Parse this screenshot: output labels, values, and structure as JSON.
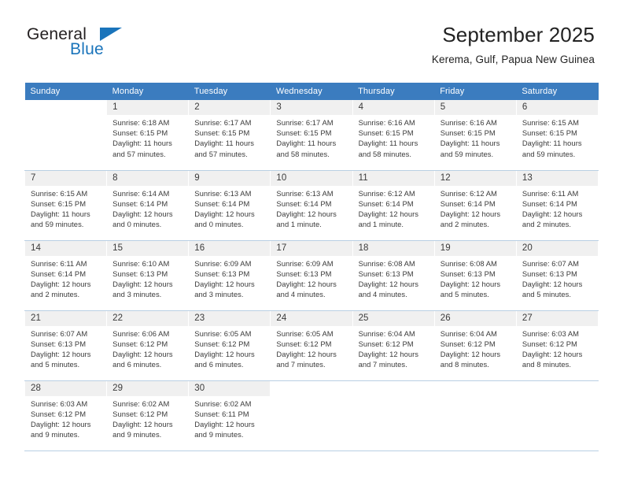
{
  "brand": {
    "name_dark": "General",
    "name_blue": "Blue",
    "accent_color": "#1a74bb"
  },
  "header": {
    "title": "September 2025",
    "subtitle": "Kerema, Gulf, Papua New Guinea"
  },
  "calendar": {
    "header_bg": "#3b7cbf",
    "daynum_bg": "#f0f0f0",
    "weekdays": [
      "Sunday",
      "Monday",
      "Tuesday",
      "Wednesday",
      "Thursday",
      "Friday",
      "Saturday"
    ],
    "weeks": [
      [
        {
          "day": "",
          "lines": []
        },
        {
          "day": "1",
          "lines": [
            "Sunrise: 6:18 AM",
            "Sunset: 6:15 PM",
            "Daylight: 11 hours",
            "and 57 minutes."
          ]
        },
        {
          "day": "2",
          "lines": [
            "Sunrise: 6:17 AM",
            "Sunset: 6:15 PM",
            "Daylight: 11 hours",
            "and 57 minutes."
          ]
        },
        {
          "day": "3",
          "lines": [
            "Sunrise: 6:17 AM",
            "Sunset: 6:15 PM",
            "Daylight: 11 hours",
            "and 58 minutes."
          ]
        },
        {
          "day": "4",
          "lines": [
            "Sunrise: 6:16 AM",
            "Sunset: 6:15 PM",
            "Daylight: 11 hours",
            "and 58 minutes."
          ]
        },
        {
          "day": "5",
          "lines": [
            "Sunrise: 6:16 AM",
            "Sunset: 6:15 PM",
            "Daylight: 11 hours",
            "and 59 minutes."
          ]
        },
        {
          "day": "6",
          "lines": [
            "Sunrise: 6:15 AM",
            "Sunset: 6:15 PM",
            "Daylight: 11 hours",
            "and 59 minutes."
          ]
        }
      ],
      [
        {
          "day": "7",
          "lines": [
            "Sunrise: 6:15 AM",
            "Sunset: 6:15 PM",
            "Daylight: 11 hours",
            "and 59 minutes."
          ]
        },
        {
          "day": "8",
          "lines": [
            "Sunrise: 6:14 AM",
            "Sunset: 6:14 PM",
            "Daylight: 12 hours",
            "and 0 minutes."
          ]
        },
        {
          "day": "9",
          "lines": [
            "Sunrise: 6:13 AM",
            "Sunset: 6:14 PM",
            "Daylight: 12 hours",
            "and 0 minutes."
          ]
        },
        {
          "day": "10",
          "lines": [
            "Sunrise: 6:13 AM",
            "Sunset: 6:14 PM",
            "Daylight: 12 hours",
            "and 1 minute."
          ]
        },
        {
          "day": "11",
          "lines": [
            "Sunrise: 6:12 AM",
            "Sunset: 6:14 PM",
            "Daylight: 12 hours",
            "and 1 minute."
          ]
        },
        {
          "day": "12",
          "lines": [
            "Sunrise: 6:12 AM",
            "Sunset: 6:14 PM",
            "Daylight: 12 hours",
            "and 2 minutes."
          ]
        },
        {
          "day": "13",
          "lines": [
            "Sunrise: 6:11 AM",
            "Sunset: 6:14 PM",
            "Daylight: 12 hours",
            "and 2 minutes."
          ]
        }
      ],
      [
        {
          "day": "14",
          "lines": [
            "Sunrise: 6:11 AM",
            "Sunset: 6:14 PM",
            "Daylight: 12 hours",
            "and 2 minutes."
          ]
        },
        {
          "day": "15",
          "lines": [
            "Sunrise: 6:10 AM",
            "Sunset: 6:13 PM",
            "Daylight: 12 hours",
            "and 3 minutes."
          ]
        },
        {
          "day": "16",
          "lines": [
            "Sunrise: 6:09 AM",
            "Sunset: 6:13 PM",
            "Daylight: 12 hours",
            "and 3 minutes."
          ]
        },
        {
          "day": "17",
          "lines": [
            "Sunrise: 6:09 AM",
            "Sunset: 6:13 PM",
            "Daylight: 12 hours",
            "and 4 minutes."
          ]
        },
        {
          "day": "18",
          "lines": [
            "Sunrise: 6:08 AM",
            "Sunset: 6:13 PM",
            "Daylight: 12 hours",
            "and 4 minutes."
          ]
        },
        {
          "day": "19",
          "lines": [
            "Sunrise: 6:08 AM",
            "Sunset: 6:13 PM",
            "Daylight: 12 hours",
            "and 5 minutes."
          ]
        },
        {
          "day": "20",
          "lines": [
            "Sunrise: 6:07 AM",
            "Sunset: 6:13 PM",
            "Daylight: 12 hours",
            "and 5 minutes."
          ]
        }
      ],
      [
        {
          "day": "21",
          "lines": [
            "Sunrise: 6:07 AM",
            "Sunset: 6:13 PM",
            "Daylight: 12 hours",
            "and 5 minutes."
          ]
        },
        {
          "day": "22",
          "lines": [
            "Sunrise: 6:06 AM",
            "Sunset: 6:12 PM",
            "Daylight: 12 hours",
            "and 6 minutes."
          ]
        },
        {
          "day": "23",
          "lines": [
            "Sunrise: 6:05 AM",
            "Sunset: 6:12 PM",
            "Daylight: 12 hours",
            "and 6 minutes."
          ]
        },
        {
          "day": "24",
          "lines": [
            "Sunrise: 6:05 AM",
            "Sunset: 6:12 PM",
            "Daylight: 12 hours",
            "and 7 minutes."
          ]
        },
        {
          "day": "25",
          "lines": [
            "Sunrise: 6:04 AM",
            "Sunset: 6:12 PM",
            "Daylight: 12 hours",
            "and 7 minutes."
          ]
        },
        {
          "day": "26",
          "lines": [
            "Sunrise: 6:04 AM",
            "Sunset: 6:12 PM",
            "Daylight: 12 hours",
            "and 8 minutes."
          ]
        },
        {
          "day": "27",
          "lines": [
            "Sunrise: 6:03 AM",
            "Sunset: 6:12 PM",
            "Daylight: 12 hours",
            "and 8 minutes."
          ]
        }
      ],
      [
        {
          "day": "28",
          "lines": [
            "Sunrise: 6:03 AM",
            "Sunset: 6:12 PM",
            "Daylight: 12 hours",
            "and 9 minutes."
          ]
        },
        {
          "day": "29",
          "lines": [
            "Sunrise: 6:02 AM",
            "Sunset: 6:12 PM",
            "Daylight: 12 hours",
            "and 9 minutes."
          ]
        },
        {
          "day": "30",
          "lines": [
            "Sunrise: 6:02 AM",
            "Sunset: 6:11 PM",
            "Daylight: 12 hours",
            "and 9 minutes."
          ]
        },
        {
          "day": "",
          "lines": []
        },
        {
          "day": "",
          "lines": []
        },
        {
          "day": "",
          "lines": []
        },
        {
          "day": "",
          "lines": []
        }
      ]
    ]
  }
}
